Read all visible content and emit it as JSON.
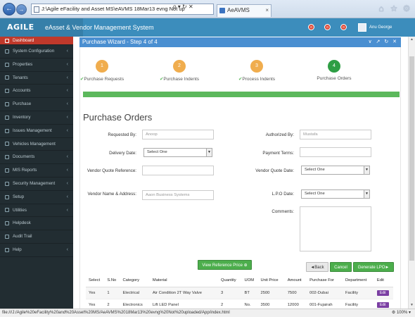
{
  "browser": {
    "address": "J:\\Agile eFacility and Asset MS\\eAVMS 18Mar13 evng Not up",
    "address_tools": "ρ ▾ ↻ ✕",
    "tab_title": "AeAVMS",
    "status_url": "file:///J:/Agile%20eFacility%20and%20Asset%20MS/AeAVMS%2018Mar13%20evng%20Not%20uploaded/App/index.html",
    "zoom": "100%"
  },
  "header": {
    "logo": "AGILE",
    "title": "eAsset & Vendor Management System",
    "notifications": [
      "0",
      "0",
      "0"
    ],
    "user_name": "Anu George"
  },
  "sidebar": {
    "items": [
      {
        "label": "Dashboard",
        "chevron": ""
      },
      {
        "label": "System Configuration",
        "chevron": "‹"
      },
      {
        "label": "Properties",
        "chevron": "‹"
      },
      {
        "label": "Tenants",
        "chevron": "‹"
      },
      {
        "label": "Accounts",
        "chevron": "‹"
      },
      {
        "label": "Purchase",
        "chevron": "‹"
      },
      {
        "label": "Inventory",
        "chevron": "‹"
      },
      {
        "label": "Issues Management",
        "chevron": "‹"
      },
      {
        "label": "Vehicles Management",
        "chevron": ""
      },
      {
        "label": "Documents",
        "chevron": "‹"
      },
      {
        "label": "MIS Reports",
        "chevron": "‹"
      },
      {
        "label": "Security Management",
        "chevron": "‹"
      },
      {
        "label": "Setup",
        "chevron": "‹"
      },
      {
        "label": "Utilities",
        "chevron": "‹"
      },
      {
        "label": "Helpdesk",
        "chevron": ""
      },
      {
        "label": "Audit Trail",
        "chevron": ""
      },
      {
        "label": "Help",
        "chevron": "‹"
      }
    ]
  },
  "panel": {
    "title": "Purchase Wizard - Step 4 of 4",
    "header_icons": "∨ ↗ ↻ ✕"
  },
  "wizard": {
    "steps": [
      {
        "number": "1",
        "label": "Purchase Requests",
        "done": true
      },
      {
        "number": "2",
        "label": "Purchase Indents",
        "done": true
      },
      {
        "number": "3",
        "label": "Process Indents",
        "done": true
      },
      {
        "number": "4",
        "label": "Purchase Orders",
        "done": false
      }
    ],
    "check_mark": "✔",
    "progress": 1.0
  },
  "form": {
    "section_title": "Purchase Orders",
    "requested_by_label": "Requested By:",
    "requested_by_value": "Anoop",
    "authorized_by_label": "Authorized By:",
    "authorized_by_value": "Mustafa",
    "delivery_date_label": "Delivery Date:",
    "delivery_date_value": "Select One",
    "payment_terms_label": "Payment Terms:",
    "payment_terms_value": "",
    "vendor_quote_ref_label": "Vendor Quote Reference:",
    "vendor_quote_ref_value": "",
    "vendor_quote_date_label": "Vendor Quote Date:",
    "vendor_quote_date_value": "Select One",
    "vendor_name_label": "Vendor Name & Address:",
    "vendor_name_value": "Aaon Business Systems",
    "lpo_date_label": "L.P.O Date:",
    "lpo_date_value": "Select One",
    "comments_label": "Comments:"
  },
  "actions": {
    "view_reference_price": "View Reference Price ⊕",
    "back": "◄Back",
    "cancel": "Cancel",
    "generate_lpo": "Generate LPO►"
  },
  "table": {
    "columns": [
      "Select",
      "S.No",
      "Category",
      "Material",
      "Quantity",
      "UOM",
      "Unit Price",
      "Amount",
      "Purchase For",
      "Department",
      "Edit"
    ],
    "rows": [
      [
        "Yes",
        "1",
        "Electrical",
        "Air Condition 2T Way Valve",
        "3",
        "BT",
        "2500",
        "7500",
        "002-Dubai",
        "Facility",
        "Edit"
      ],
      [
        "Yes",
        "2",
        "Electronics",
        "Lift LED Panel",
        "2",
        "No.",
        "3500",
        "12000",
        "001-Fujairah",
        "Facility",
        "Edit"
      ]
    ]
  }
}
